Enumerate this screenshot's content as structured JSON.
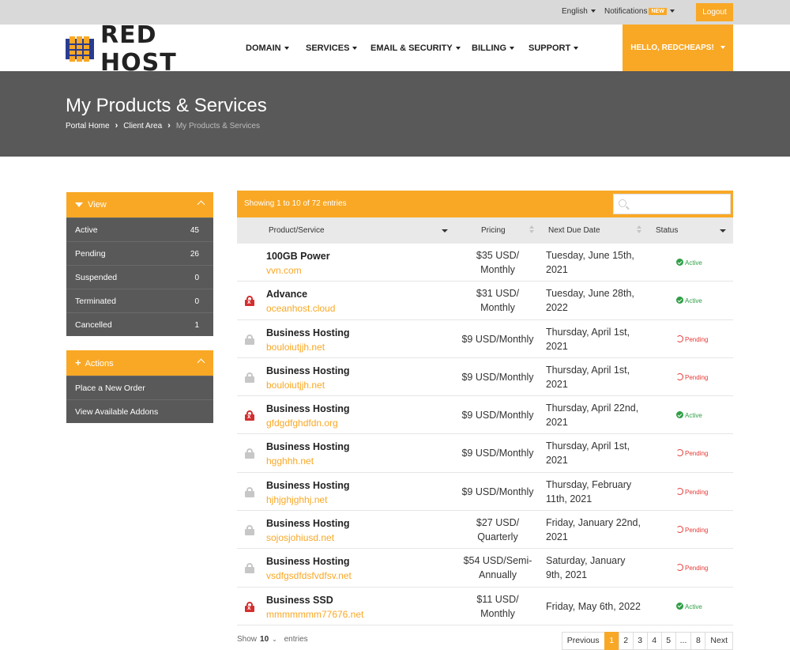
{
  "topbar": {
    "language": "English",
    "notifications": "Notifications",
    "new_badge": "NEW",
    "logout": "Logout"
  },
  "brand": {
    "name": "RED HOST",
    "accent": "#f9a825"
  },
  "nav": {
    "items": [
      "DOMAIN",
      "SERVICES",
      "EMAIL & SECURITY",
      "BILLING",
      "SUPPORT"
    ],
    "user": "HELLO, REDCHEAPS!"
  },
  "banner": {
    "title": "My Products & Services",
    "breadcrumb": [
      "Portal Home",
      "Client Area",
      "My Products & Services"
    ]
  },
  "sidebar": {
    "view": {
      "title": "View",
      "items": [
        {
          "label": "Active",
          "count": "45"
        },
        {
          "label": "Pending",
          "count": "26"
        },
        {
          "label": "Suspended",
          "count": "0"
        },
        {
          "label": "Terminated",
          "count": "0"
        },
        {
          "label": "Cancelled",
          "count": "1"
        }
      ]
    },
    "actions": {
      "title": "Actions",
      "items": [
        "Place a New Order",
        "View Available Addons"
      ]
    }
  },
  "table": {
    "info": "Showing 1 to 10 of 72 entries",
    "search_placeholder": "",
    "headers": [
      "Product/Service",
      "Pricing",
      "Next Due Date",
      "Status"
    ],
    "rows": [
      {
        "lock": "none",
        "name": "100GB Power",
        "domain": "vvn.com",
        "price1": "$35 USD/",
        "price2": "Monthly",
        "due1": "Tuesday, June 15th,",
        "due2": "2021",
        "status": "Active"
      },
      {
        "lock": "red",
        "name": "Advance",
        "domain": "oceanhost.cloud",
        "price1": "$31 USD/",
        "price2": "Monthly",
        "due1": "Tuesday, June 28th,",
        "due2": "2022",
        "status": "Active"
      },
      {
        "lock": "grey",
        "name": "Business Hosting",
        "domain": "bouloiutjjh.net",
        "price1": "$9 USD/Monthly",
        "price2": "",
        "due1": "Thursday, April 1st,",
        "due2": "2021",
        "status": "Pending"
      },
      {
        "lock": "grey",
        "name": "Business Hosting",
        "domain": "bouloiutjjh.net",
        "price1": "$9 USD/Monthly",
        "price2": "",
        "due1": "Thursday, April 1st,",
        "due2": "2021",
        "status": "Pending"
      },
      {
        "lock": "red",
        "name": "Business Hosting",
        "domain": "gfdgdfghdfdn.org",
        "price1": "$9 USD/Monthly",
        "price2": "",
        "due1": "Thursday, April 22nd,",
        "due2": "2021",
        "status": "Active"
      },
      {
        "lock": "grey",
        "name": "Business Hosting",
        "domain": "hgghhh.net",
        "price1": "$9 USD/Monthly",
        "price2": "",
        "due1": "Thursday, April 1st,",
        "due2": "2021",
        "status": "Pending"
      },
      {
        "lock": "grey",
        "name": "Business Hosting",
        "domain": "hjhjghjghhj.net",
        "price1": "$9 USD/Monthly",
        "price2": "",
        "due1": "Thursday, February",
        "due2": "11th, 2021",
        "status": "Pending"
      },
      {
        "lock": "grey",
        "name": "Business Hosting",
        "domain": "sojosjohiusd.net",
        "price1": "$27 USD/",
        "price2": "Quarterly",
        "due1": "Friday, January 22nd,",
        "due2": "2021",
        "status": "Pending"
      },
      {
        "lock": "grey",
        "name": "Business Hosting",
        "domain": "vsdfgsdfdsfvdfsv.net",
        "price1": "$54 USD/Semi-",
        "price2": "Annually",
        "due1": "Saturday, January",
        "due2": "9th, 2021",
        "status": "Pending"
      },
      {
        "lock": "red",
        "name": "Business SSD",
        "domain": "mmmmmmm77676.net",
        "price1": "$11 USD/",
        "price2": "Monthly",
        "due1": "Friday, May 6th, 2022",
        "due2": "",
        "status": "Active"
      }
    ]
  },
  "footer": {
    "show_label": "Show",
    "show_value": "10",
    "entries_label": "entries",
    "pages": [
      "Previous",
      "1",
      "2",
      "3",
      "4",
      "5",
      "...",
      "8",
      "Next"
    ],
    "current_page": "1"
  }
}
